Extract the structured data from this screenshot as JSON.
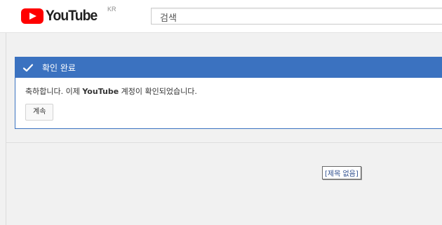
{
  "header": {
    "logo_text": "YouTube",
    "country_code": "KR",
    "search_placeholder": "검색"
  },
  "alert": {
    "title": "확인 완료",
    "message_prefix": "축하합니다. 이제 ",
    "message_brand": "YouTube",
    "message_suffix": " 계정이 확인되었습니다.",
    "continue_label": "계속"
  },
  "untitled_link": "[제목 없음]",
  "colors": {
    "brand_red": "#ff0000",
    "alert_blue": "#3b72c0"
  },
  "icons": {
    "play": "play-icon",
    "check": "check-icon"
  }
}
